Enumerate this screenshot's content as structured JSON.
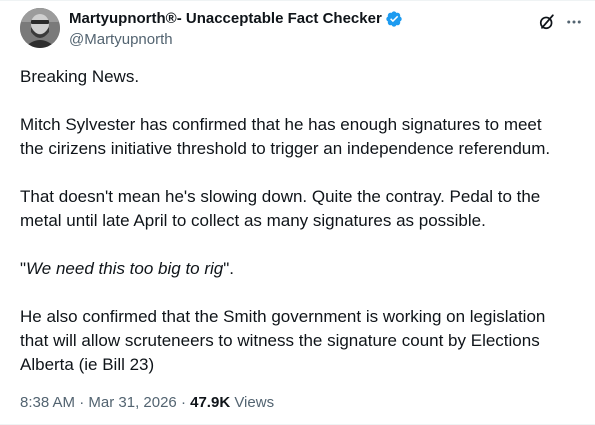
{
  "author": {
    "display_name": "Martyupnorth®- Unacceptable Fact Checker",
    "handle": "@Martyupnorth",
    "verified_color": "#1d9bf0"
  },
  "header_actions": {
    "grok_icon": "grok-icon",
    "more_icon": "more-horizontal-icon"
  },
  "tweet": {
    "p1": "Breaking News.",
    "p2_line1": "Mitch Sylvester has confirmed that he has enough signatures to meet",
    "p2_line2": "the cirizens initiative threshold to trigger an independence referendum.",
    "p3_line1": "That doesn't mean he's slowing down. Quite the contray. Pedal to the",
    "p3_line2": "metal until late April to collect as many signatures as possible.",
    "p4_open_quote": "\"",
    "p4_quote": "We need this too big to rig",
    "p4_close": "\".",
    "p5_line1": "He also confirmed that the Smith government is working on legislation",
    "p5_line2": "that will allow scruteneers to witness the signature count by Elections",
    "p5_line3": "Alberta (ie Bill 23)"
  },
  "meta": {
    "time": "8:38 AM",
    "sep1": " · ",
    "date": "Mar 31, 2026",
    "sep2": " · ",
    "views_count": "47.9K",
    "views_label": " Views"
  }
}
